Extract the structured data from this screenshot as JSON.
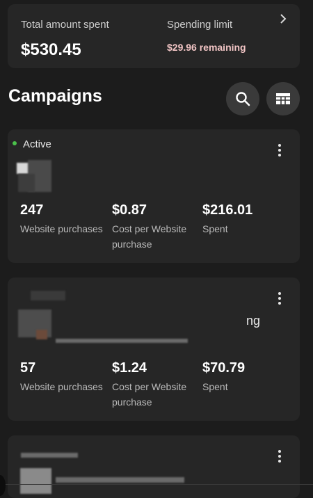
{
  "summary": {
    "total_label": "Total amount spent",
    "total_value": "$530.45",
    "limit_label": "Spending limit",
    "limit_remaining": "$29.96 remaining",
    "chevron_icon": "chevron-right-icon"
  },
  "campaigns_section": {
    "title": "Campaigns",
    "search_icon": "search-icon",
    "table_icon": "table-icon"
  },
  "campaigns": [
    {
      "status": "Active",
      "status_color": "#4bc24b",
      "metrics": [
        {
          "value": "247",
          "label": "Website purchases"
        },
        {
          "value": "$0.87",
          "label": "Cost per Website purchase"
        },
        {
          "value": "$216.01",
          "label": "Spent"
        }
      ]
    },
    {
      "name_fragment": "ng",
      "metrics": [
        {
          "value": "57",
          "label": "Website purchases"
        },
        {
          "value": "$1.24",
          "label": "Cost per Website purchase"
        },
        {
          "value": "$70.79",
          "label": "Spent"
        }
      ]
    }
  ],
  "colors": {
    "background": "#1c1c1c",
    "card": "#262626",
    "remaining_text": "#f2c5c5"
  }
}
